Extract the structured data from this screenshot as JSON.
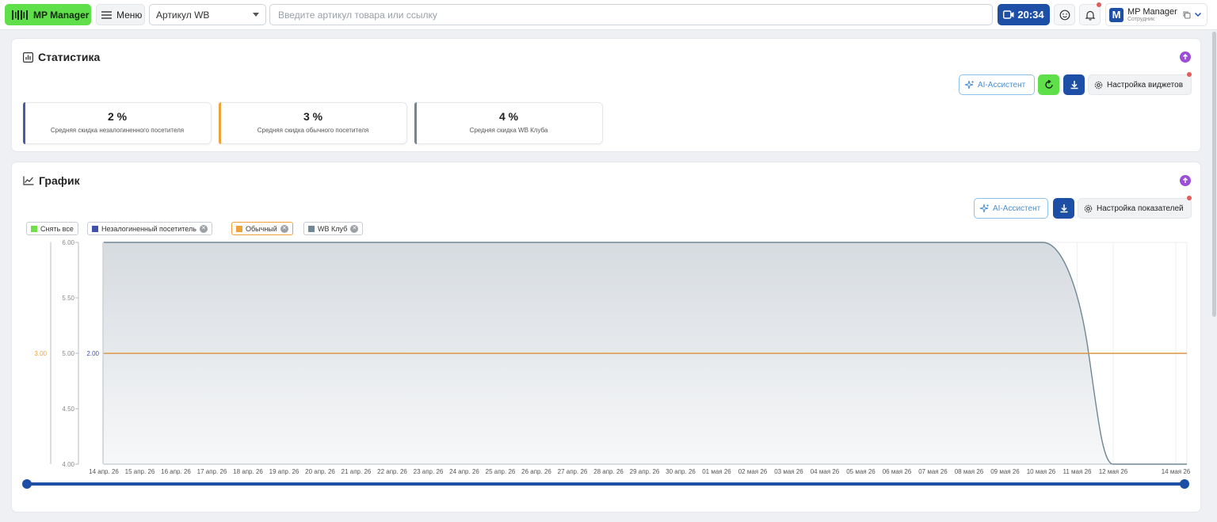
{
  "topbar": {
    "logo_label": "MP Manager",
    "menu_label": "Меню",
    "article_select": "Артикул WB",
    "search_placeholder": "Введите артикул товара или ссылку",
    "time": "20:34",
    "user_name": "MP Manager",
    "user_role": "Сотрудник",
    "user_initial": "M"
  },
  "stats": {
    "title": "Статистика",
    "ai_label": "AI-Ассистент",
    "settings_label": "Настройка виджетов",
    "cards": [
      {
        "value": "2 %",
        "label": "Средняя скидка незалогиненного посетителя",
        "color": "#4a5aa8"
      },
      {
        "value": "3 %",
        "label": "Средняя скидка обычного посетителя",
        "color": "#f0a23a"
      },
      {
        "value": "4 %",
        "label": "Средняя скидка WB Клуба",
        "color": "#6f8796"
      }
    ]
  },
  "graph": {
    "title": "График",
    "ai_label": "AI-Ассистент",
    "settings_label": "Настройка показателей",
    "legend": {
      "clear_all": "Снять все",
      "items": [
        {
          "label": "Незалогиненный посетитель",
          "color": "#3f51a8"
        },
        {
          "label": "Обычный",
          "color": "#f0a23a"
        },
        {
          "label": "WB Клуб",
          "color": "#6f8796"
        }
      ]
    }
  },
  "chart_data": {
    "type": "line",
    "x": [
      "14 апр. 26",
      "15 апр. 26",
      "16 апр. 26",
      "17 апр. 26",
      "18 апр. 26",
      "19 апр. 26",
      "20 апр. 26",
      "21 апр. 26",
      "22 апр. 26",
      "23 апр. 26",
      "24 апр. 26",
      "25 апр. 26",
      "26 апр. 26",
      "27 апр. 26",
      "28 апр. 26",
      "29 апр. 26",
      "30 апр. 26",
      "01 мая 26",
      "02 мая 26",
      "03 мая 26",
      "04 мая 26",
      "05 мая 26",
      "06 мая 26",
      "07 мая 26",
      "08 мая 26",
      "09 мая 26",
      "10 мая 26",
      "11 мая 26",
      "12 мая 26",
      "14 мая 26"
    ],
    "series": [
      {
        "name": "Незалогиненный посетитель",
        "axis": "inner",
        "color": "#3f51a8",
        "values": [
          2,
          2,
          2,
          2,
          2,
          2,
          2,
          2,
          2,
          2,
          2,
          2,
          2,
          2,
          2,
          2,
          2,
          2,
          2,
          2,
          2,
          2,
          2,
          2,
          2,
          2,
          2,
          2,
          2,
          2
        ]
      },
      {
        "name": "Обычный",
        "axis": "left",
        "color": "#f0a23a",
        "values": [
          3,
          3,
          3,
          3,
          3,
          3,
          3,
          3,
          3,
          3,
          3,
          3,
          3,
          3,
          3,
          3,
          3,
          3,
          3,
          3,
          3,
          3,
          3,
          3,
          3,
          3,
          3,
          3,
          3,
          3
        ]
      },
      {
        "name": "WB Клуб",
        "axis": "middle",
        "color": "#6f8796",
        "values": [
          6,
          6,
          6,
          6,
          6,
          6,
          6,
          6,
          6,
          6,
          6,
          6,
          6,
          6,
          6,
          6,
          6,
          6,
          6,
          6,
          6,
          6,
          6,
          6,
          6,
          6,
          6,
          5.6,
          4,
          4
        ]
      }
    ],
    "middle_axis_ticks": [
      "6.00",
      "5.50",
      "5.00",
      "4.50",
      "4.00"
    ],
    "left_axis_tick": "3.00",
    "inner_axis_tick": "2.00",
    "ylim_middle": [
      4,
      6
    ]
  }
}
